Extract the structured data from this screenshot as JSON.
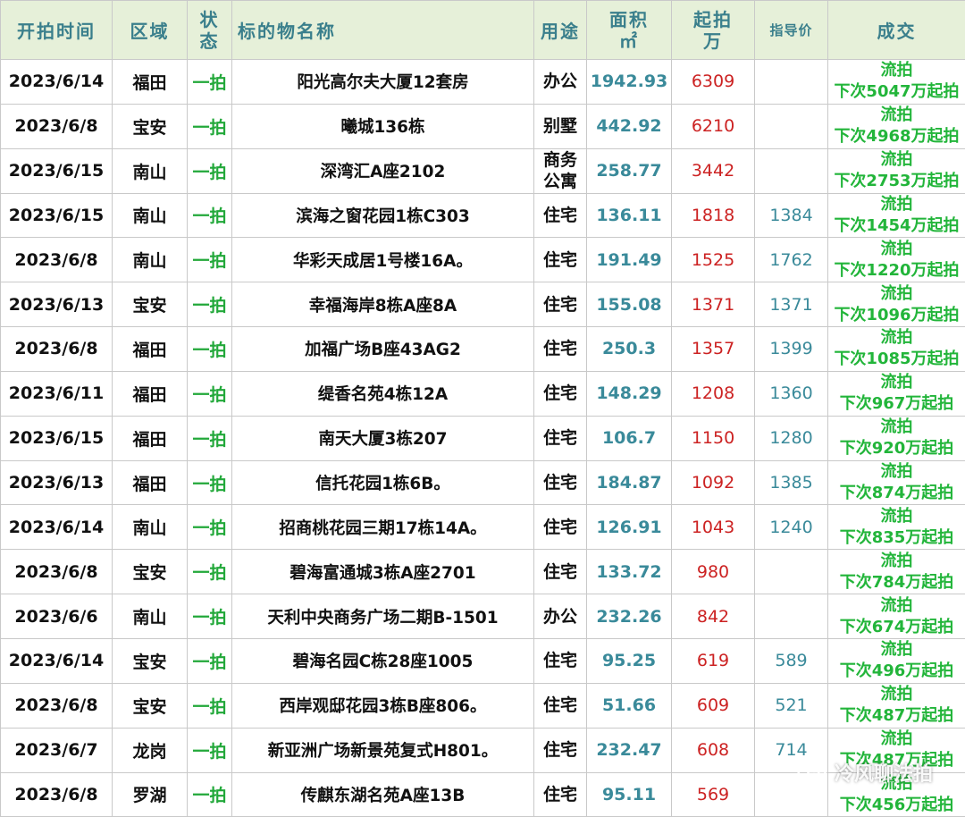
{
  "headers": {
    "date": "开拍时间",
    "district": "区域",
    "status": [
      "状",
      "态"
    ],
    "name": "标的物名称",
    "use": "用途",
    "area": [
      "面积",
      "㎡"
    ],
    "start_price": [
      "起拍",
      "万"
    ],
    "guide_price": "指导价",
    "deal": "成交"
  },
  "rows": [
    {
      "date": "2023/6/14",
      "district": "福田",
      "status": "一拍",
      "name": "阳光高尔夫大厦12套房",
      "use": [
        "办公"
      ],
      "area": "1942.93",
      "start": "6309",
      "guide": "",
      "deal": [
        "流拍",
        "下次5047万起拍"
      ]
    },
    {
      "date": "2023/6/8",
      "district": "宝安",
      "status": "一拍",
      "name": "曦城136栋",
      "use": [
        "别墅"
      ],
      "area": "442.92",
      "start": "6210",
      "guide": "",
      "deal": [
        "流拍",
        "下次4968万起拍"
      ]
    },
    {
      "date": "2023/6/15",
      "district": "南山",
      "status": "一拍",
      "name": "深湾汇A座2102",
      "use": [
        "商务",
        "公寓"
      ],
      "area": "258.77",
      "start": "3442",
      "guide": "",
      "deal": [
        "流拍",
        "下次2753万起拍"
      ]
    },
    {
      "date": "2023/6/15",
      "district": "南山",
      "status": "一拍",
      "name": "滨海之窗花园1栋C303",
      "use": [
        "住宅"
      ],
      "area": "136.11",
      "start": "1818",
      "guide": "1384",
      "deal": [
        "流拍",
        "下次1454万起拍"
      ]
    },
    {
      "date": "2023/6/8",
      "district": "南山",
      "status": "一拍",
      "name": "华彩天成居1号楼16A。",
      "use": [
        "住宅"
      ],
      "area": "191.49",
      "start": "1525",
      "guide": "1762",
      "deal": [
        "流拍",
        "下次1220万起拍"
      ]
    },
    {
      "date": "2023/6/13",
      "district": "宝安",
      "status": "一拍",
      "name": "幸福海岸8栋A座8A",
      "use": [
        "住宅"
      ],
      "area": "155.08",
      "start": "1371",
      "guide": "1371",
      "deal": [
        "流拍",
        "下次1096万起拍"
      ]
    },
    {
      "date": "2023/6/8",
      "district": "福田",
      "status": "一拍",
      "name": "加福广场B座43AG2",
      "use": [
        "住宅"
      ],
      "area": "250.3",
      "start": "1357",
      "guide": "1399",
      "deal": [
        "流拍",
        "下次1085万起拍"
      ]
    },
    {
      "date": "2023/6/11",
      "district": "福田",
      "status": "一拍",
      "name": "缇香名苑4栋12A",
      "use": [
        "住宅"
      ],
      "area": "148.29",
      "start": "1208",
      "guide": "1360",
      "deal": [
        "流拍",
        "下次967万起拍"
      ]
    },
    {
      "date": "2023/6/15",
      "district": "福田",
      "status": "一拍",
      "name": "南天大厦3栋207",
      "use": [
        "住宅"
      ],
      "area": "106.7",
      "start": "1150",
      "guide": "1280",
      "deal": [
        "流拍",
        "下次920万起拍"
      ]
    },
    {
      "date": "2023/6/13",
      "district": "福田",
      "status": "一拍",
      "name": "信托花园1栋6B。",
      "use": [
        "住宅"
      ],
      "area": "184.87",
      "start": "1092",
      "guide": "1385",
      "deal": [
        "流拍",
        "下次874万起拍"
      ]
    },
    {
      "date": "2023/6/14",
      "district": "南山",
      "status": "一拍",
      "name": "招商桃花园三期17栋14A。",
      "use": [
        "住宅"
      ],
      "area": "126.91",
      "start": "1043",
      "guide": "1240",
      "deal": [
        "流拍",
        "下次835万起拍"
      ]
    },
    {
      "date": "2023/6/8",
      "district": "宝安",
      "status": "一拍",
      "name": "碧海富通城3栋A座2701",
      "use": [
        "住宅"
      ],
      "area": "133.72",
      "start": "980",
      "guide": "",
      "deal": [
        "流拍",
        "下次784万起拍"
      ]
    },
    {
      "date": "2023/6/6",
      "district": "南山",
      "status": "一拍",
      "name": "天利中央商务广场二期B-1501",
      "use": [
        "办公"
      ],
      "area": "232.26",
      "start": "842",
      "guide": "",
      "deal": [
        "流拍",
        "下次674万起拍"
      ]
    },
    {
      "date": "2023/6/14",
      "district": "宝安",
      "status": "一拍",
      "name": "碧海名园C栋28座1005",
      "use": [
        "住宅"
      ],
      "area": "95.25",
      "start": "619",
      "guide": "589",
      "deal": [
        "流拍",
        "下次496万起拍"
      ]
    },
    {
      "date": "2023/6/8",
      "district": "宝安",
      "status": "一拍",
      "name": "西岸观邸花园3栋B座806。",
      "use": [
        "住宅"
      ],
      "area": "51.66",
      "start": "609",
      "guide": "521",
      "deal": [
        "流拍",
        "下次487万起拍"
      ]
    },
    {
      "date": "2023/6/7",
      "district": "龙岗",
      "status": "一拍",
      "name": "新亚洲广场新景苑复式H801。",
      "use": [
        "住宅"
      ],
      "area": "232.47",
      "start": "608",
      "guide": "714",
      "deal": [
        "流拍",
        "下次487万起拍"
      ]
    },
    {
      "date": "2023/6/8",
      "district": "罗湖",
      "status": "一拍",
      "name": "传麒东湖名苑A座13B",
      "use": [
        "住宅"
      ],
      "area": "95.11",
      "start": "569",
      "guide": "",
      "deal": [
        "流拍",
        "下次456万起拍"
      ]
    }
  ],
  "watermark": {
    "text": "冷风聊法拍",
    "icon": "wechat-icon"
  }
}
